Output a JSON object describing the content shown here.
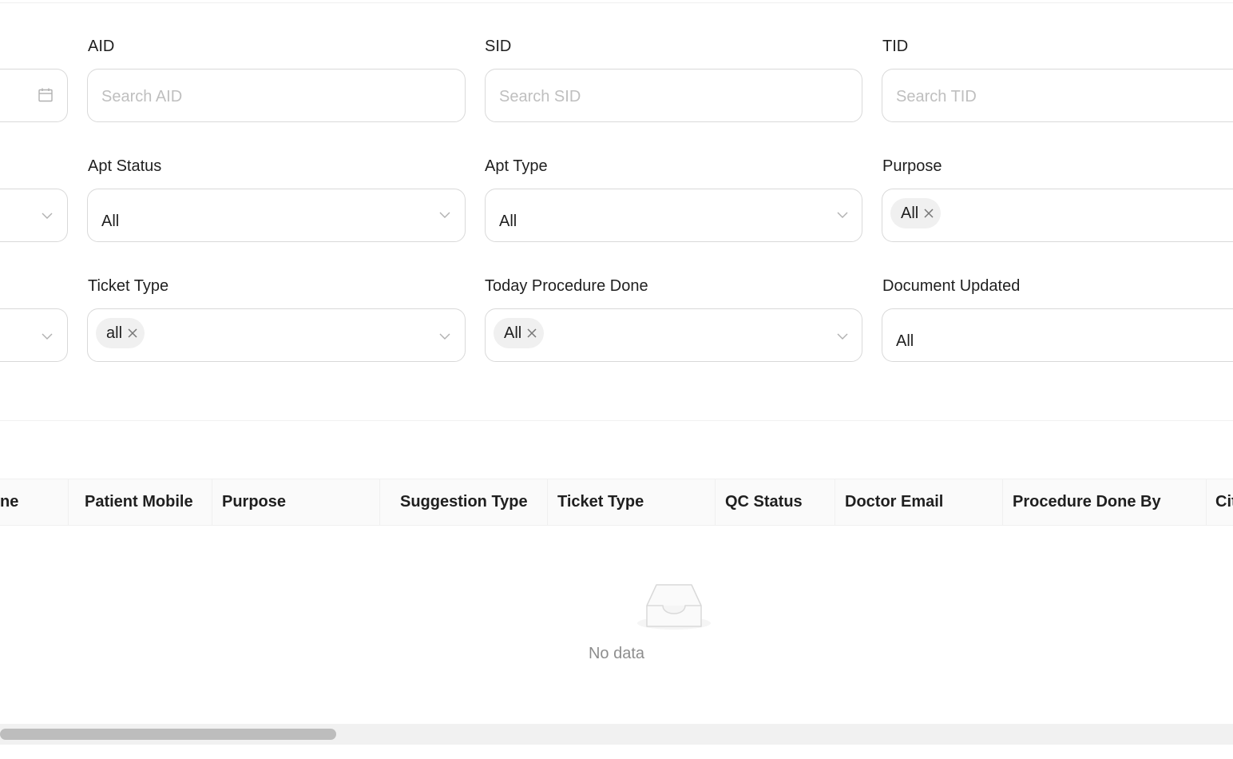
{
  "filters": {
    "row1": {
      "aid": {
        "label": "AID",
        "placeholder": "Search AID"
      },
      "sid": {
        "label": "SID",
        "placeholder": "Search SID"
      },
      "tid": {
        "label": "TID",
        "placeholder": "Search TID"
      }
    },
    "row2": {
      "apt_status": {
        "label": "Apt Status",
        "value": "All"
      },
      "apt_type": {
        "label": "Apt Type",
        "value": "All"
      },
      "purpose": {
        "label": "Purpose",
        "tag": "All"
      }
    },
    "row3": {
      "ticket_type": {
        "label": "Ticket Type",
        "tag": "all"
      },
      "today_procedure_done": {
        "label": "Today Procedure Done",
        "tag": "All"
      },
      "document_updated": {
        "label": "Document Updated",
        "value": "All"
      }
    }
  },
  "table": {
    "columns": [
      "ne",
      "Patient Mobile",
      "Purpose",
      "Suggestion Type",
      "Ticket Type",
      "QC Status",
      "Doctor Email",
      "Procedure Done By",
      "Cit"
    ],
    "empty_text": "No data"
  },
  "icons": {
    "date_picker": "calendar-icon",
    "select": "chevron-down-icon",
    "tag_remove": "close-icon",
    "empty": "empty-inbox-icon"
  }
}
